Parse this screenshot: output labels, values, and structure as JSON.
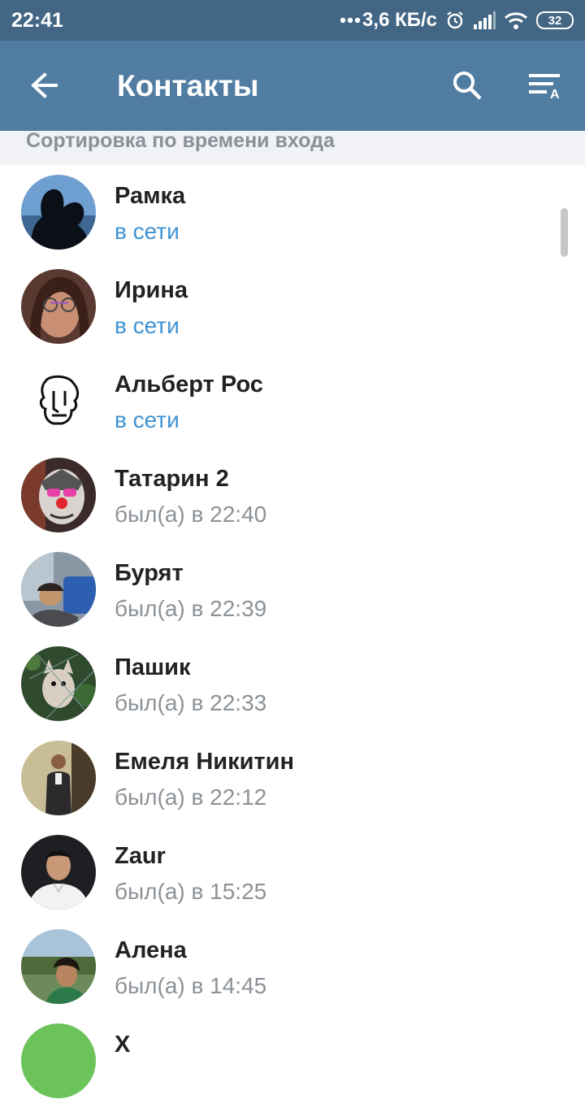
{
  "status_bar": {
    "time": "22:41",
    "network_speed": "3,6 КБ/с",
    "battery": "32",
    "icons": [
      "more-dots-icon",
      "alarm-icon",
      "signal-icon",
      "wifi-icon",
      "battery-icon"
    ]
  },
  "app_bar": {
    "title": "Контакты",
    "back_icon": "arrow-back-icon",
    "search_icon": "search-icon",
    "sort_icon": "sort-alpha-icon"
  },
  "section_header": "Сортировка по времени входа",
  "contacts": [
    {
      "name": "Рамка",
      "status": "в сети",
      "online": true
    },
    {
      "name": "Ирина",
      "status": "в сети",
      "online": true
    },
    {
      "name": "Альберт Рос",
      "status": "в сети",
      "online": true
    },
    {
      "name": "Татарин 2",
      "status": "был(а) в 22:40",
      "online": false
    },
    {
      "name": "Бурят",
      "status": "был(а) в 22:39",
      "online": false
    },
    {
      "name": "Пашик",
      "status": "был(а) в 22:33",
      "online": false
    },
    {
      "name": "Емеля Никитин",
      "status": "был(а) в 22:12",
      "online": false
    },
    {
      "name": "Zaur",
      "status": "был(а) в 15:25",
      "online": false
    },
    {
      "name": "Алена",
      "status": "был(а) в 14:45",
      "online": false
    },
    {
      "name": "Х",
      "status": "",
      "online": false
    }
  ],
  "colors": {
    "status_bar": "#426683",
    "app_bar": "#517da2",
    "online": "#3e93d3",
    "offline": "#8c9297",
    "section_bg": "#f0f2f5"
  }
}
